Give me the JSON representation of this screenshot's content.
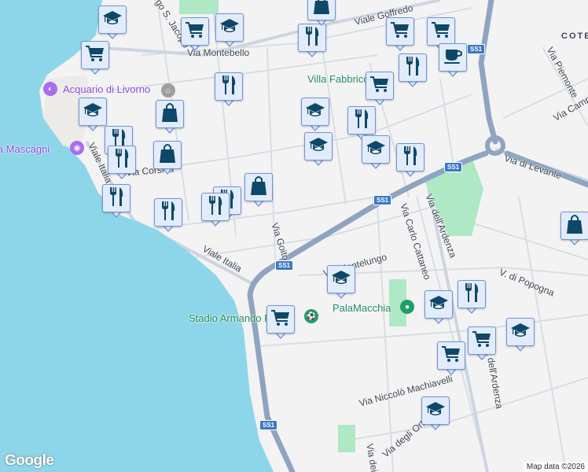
{
  "map": {
    "labels": {
      "viale_goffredo": "Viale Goffredo",
      "via_montebello": "Via Montebello",
      "borgo_s_jacopo": "Borgo S. Jacopo",
      "acquario": "Acquario di Livorno",
      "piazza_mascagni": "Piazza Mascagni",
      "viale_italia_n": "Viale Italia",
      "via_corsica": "Via Corsica",
      "villa_fabbricotti": "Villa Fabbricotti",
      "coteto": "COTETO",
      "via_piemonte": "Via Piemonte",
      "via_campania": "Via Campania",
      "via_di_levante": "Via di Levante",
      "via_dell_ardenza": "Via dell'Ardenza",
      "via_carlo_cattaneo": "Via Carlo Cattaneo",
      "via_goito": "Via Goito",
      "viale_italia_s": "Viale Italia",
      "via_montelungo": "Via Montelungo",
      "v_di_popogna": "V. di Popogna",
      "palamacchia": "PalaMacchia",
      "stadio": "Stadio Armando Picchi",
      "via_machiavelli": "Via Niccolò Machiavelli",
      "ardenza_s": "Via dell'Ardenza",
      "via_degli_orti": "Via degli Orti",
      "via_dei": "Via dei"
    },
    "route_shields": [
      "SS1",
      "SS1",
      "SS1",
      "SS1",
      "SS1"
    ],
    "markers": [
      "graduation",
      "cart",
      "cart",
      "graduation",
      "food",
      "shop",
      "cart",
      "cart",
      "cup",
      "food",
      "cart",
      "food",
      "graduation",
      "shop",
      "graduation",
      "food",
      "food",
      "food",
      "shop",
      "graduation",
      "graduation",
      "food",
      "food",
      "shop",
      "food",
      "food",
      "food",
      "shop",
      "graduation",
      "cart",
      "graduation",
      "food",
      "cart",
      "graduation",
      "cart",
      "graduation"
    ],
    "google_logo": "Google",
    "attribution": "Map data ©2026"
  },
  "colors": {
    "water": "#8dd6ea",
    "highway": "#8ea4c1",
    "park": "#aee8c4",
    "marker_icon": "#0e4869"
  }
}
